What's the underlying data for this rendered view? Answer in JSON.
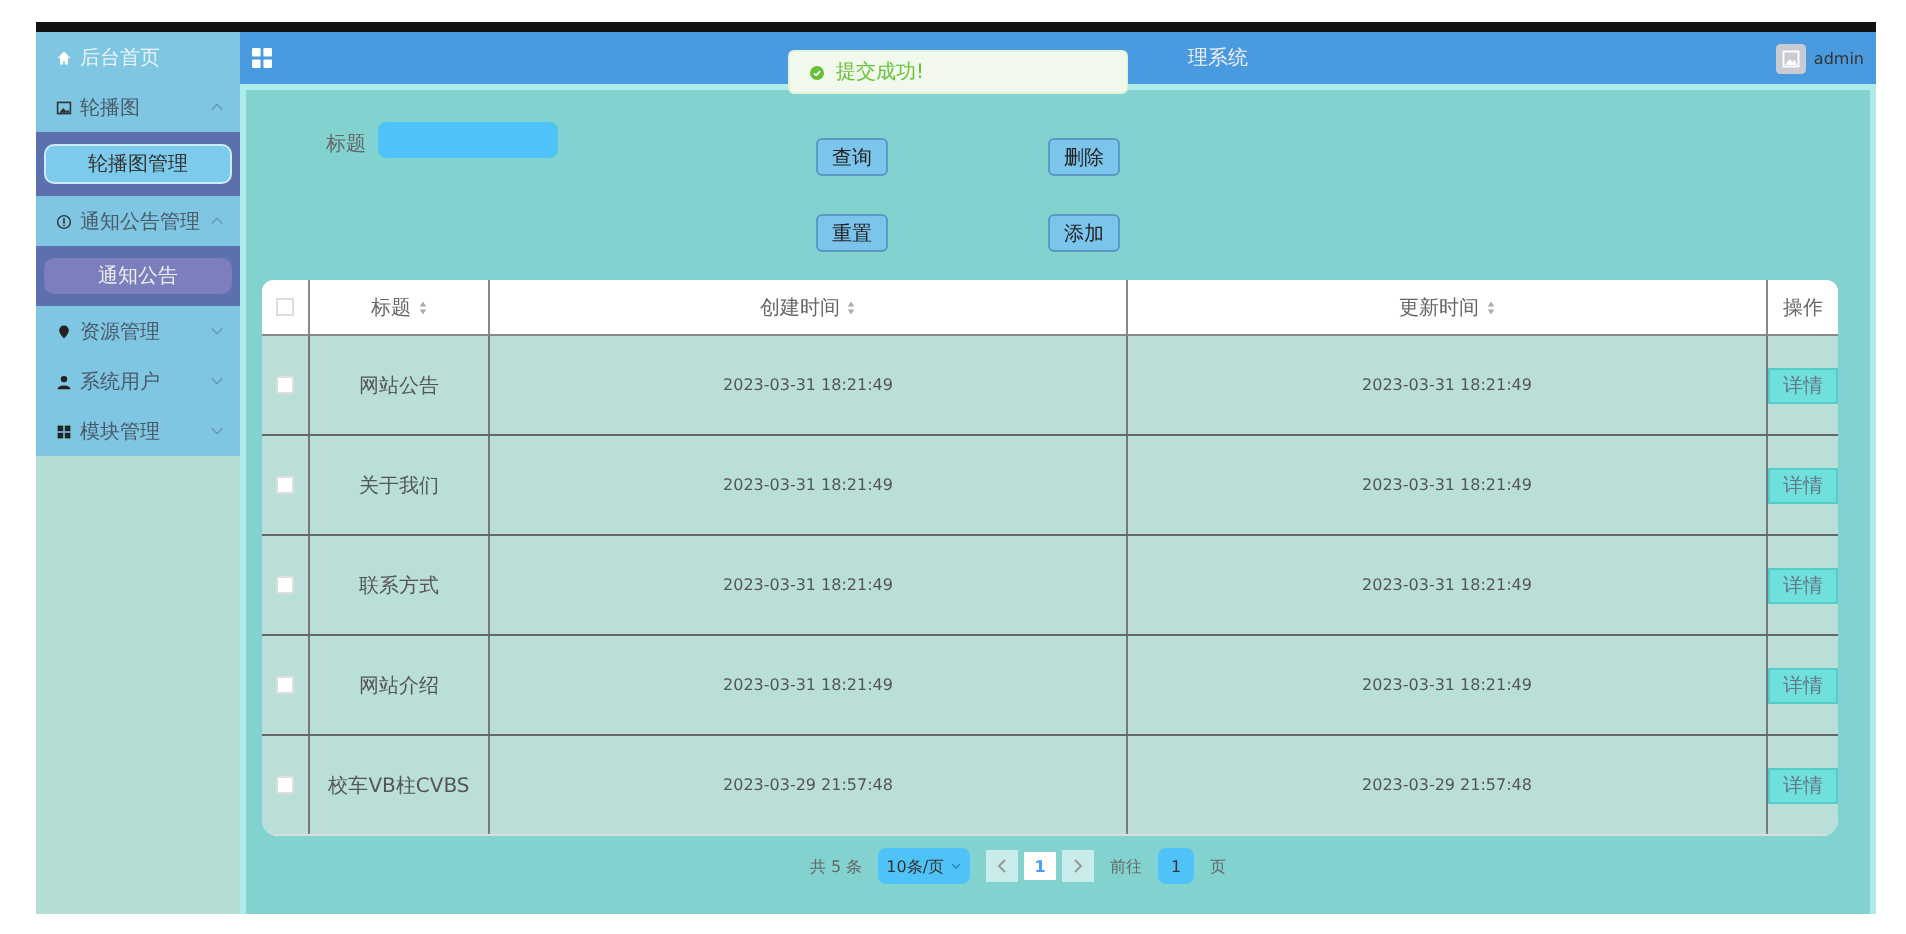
{
  "sidebar": {
    "items": [
      {
        "label": "后台首页",
        "kind": "home"
      },
      {
        "label": "轮播图",
        "kind": "image",
        "expanded": true,
        "children": [
          {
            "label": "轮播图管理",
            "selected": true
          }
        ]
      },
      {
        "label": "通知公告管理",
        "kind": "info",
        "expanded": true,
        "children": [
          {
            "label": "通知公告",
            "selected": false
          }
        ]
      },
      {
        "label": "资源管理",
        "kind": "pin",
        "expanded": false
      },
      {
        "label": "系统用户",
        "kind": "user",
        "expanded": false
      },
      {
        "label": "模块管理",
        "kind": "grid",
        "expanded": false
      }
    ]
  },
  "header": {
    "title": "理系统",
    "user": "admin"
  },
  "toast": {
    "message": "提交成功!"
  },
  "search": {
    "label": "标题"
  },
  "buttons": [
    "查询",
    "删除",
    "重置",
    "添加"
  ],
  "table": {
    "select_all_checked": false,
    "columns": [
      {
        "label": "标题",
        "sortable": true
      },
      {
        "label": "创建时间",
        "sortable": true
      },
      {
        "label": "更新时间",
        "sortable": true
      },
      {
        "label": "操作",
        "sortable": false
      }
    ],
    "rows": [
      {
        "checked": false,
        "title": "网站公告",
        "created": "2023-03-31 18:21:49",
        "updated": "2023-03-31 18:21:49",
        "action": "详情"
      },
      {
        "checked": false,
        "title": "关于我们",
        "created": "2023-03-31 18:21:49",
        "updated": "2023-03-31 18:21:49",
        "action": "详情"
      },
      {
        "checked": false,
        "title": "联系方式",
        "created": "2023-03-31 18:21:49",
        "updated": "2023-03-31 18:21:49",
        "action": "详情"
      },
      {
        "checked": false,
        "title": "网站介绍",
        "created": "2023-03-31 18:21:49",
        "updated": "2023-03-31 18:21:49",
        "action": "详情"
      },
      {
        "checked": false,
        "title": "校车VB柱CVBS",
        "created": "2023-03-29 21:57:48",
        "updated": "2023-03-29 21:57:48",
        "action": "详情"
      }
    ]
  },
  "pagination": {
    "total": "共 5 条",
    "page_size": "10条/页",
    "pages": [
      {
        "label": "1",
        "selected": true
      }
    ],
    "goto_label": "前往",
    "goto_value": "1",
    "goto_suffix": "页"
  }
}
